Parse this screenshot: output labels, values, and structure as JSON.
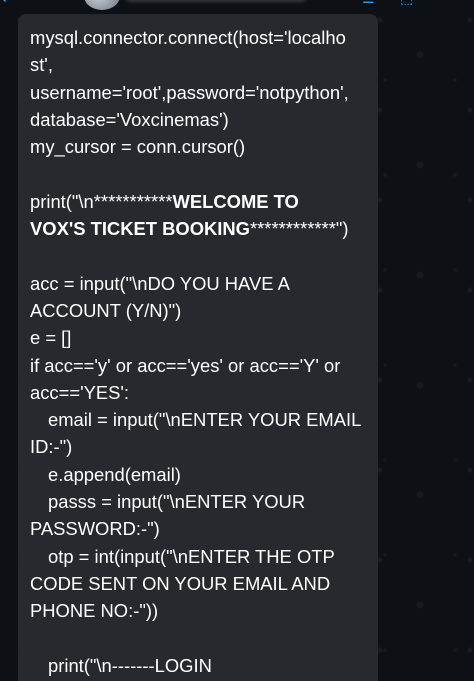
{
  "header": {
    "back_icon": "chevron-left-icon",
    "accent": "#2aa1ff"
  },
  "message": {
    "bubble_color": "#26292d",
    "text_color": "#ffffff",
    "lines": [
      "mysql.connector.connect(host='localho",
      "st',",
      "username='root',password='notpython',",
      "database='Voxcinemas')",
      "my_cursor = conn.cursor()",
      "",
      "print(\"\\n***********",
      "WELCOME TO",
      "VOX'S TICKET BOOKING",
      "************\")",
      "",
      "acc = input(\"\\nDO YOU HAVE A",
      "ACCOUNT (Y/N)\")",
      "e = []",
      "if acc=='y' or acc=='yes' or acc=='Y' or",
      "acc=='YES':",
      "email = input(\"\\nENTER YOUR EMAIL",
      "ID:-\")",
      "e.append(email)",
      "passs = input(\"\\nENTER YOUR",
      "PASSWORD:-\")",
      "otp = int(input(\"\\nENTER THE OTP",
      "CODE SENT ON YOUR EMAIL AND",
      "PHONE NO:-\"))",
      "",
      "print(\"\\n-------LOGIN"
    ]
  }
}
